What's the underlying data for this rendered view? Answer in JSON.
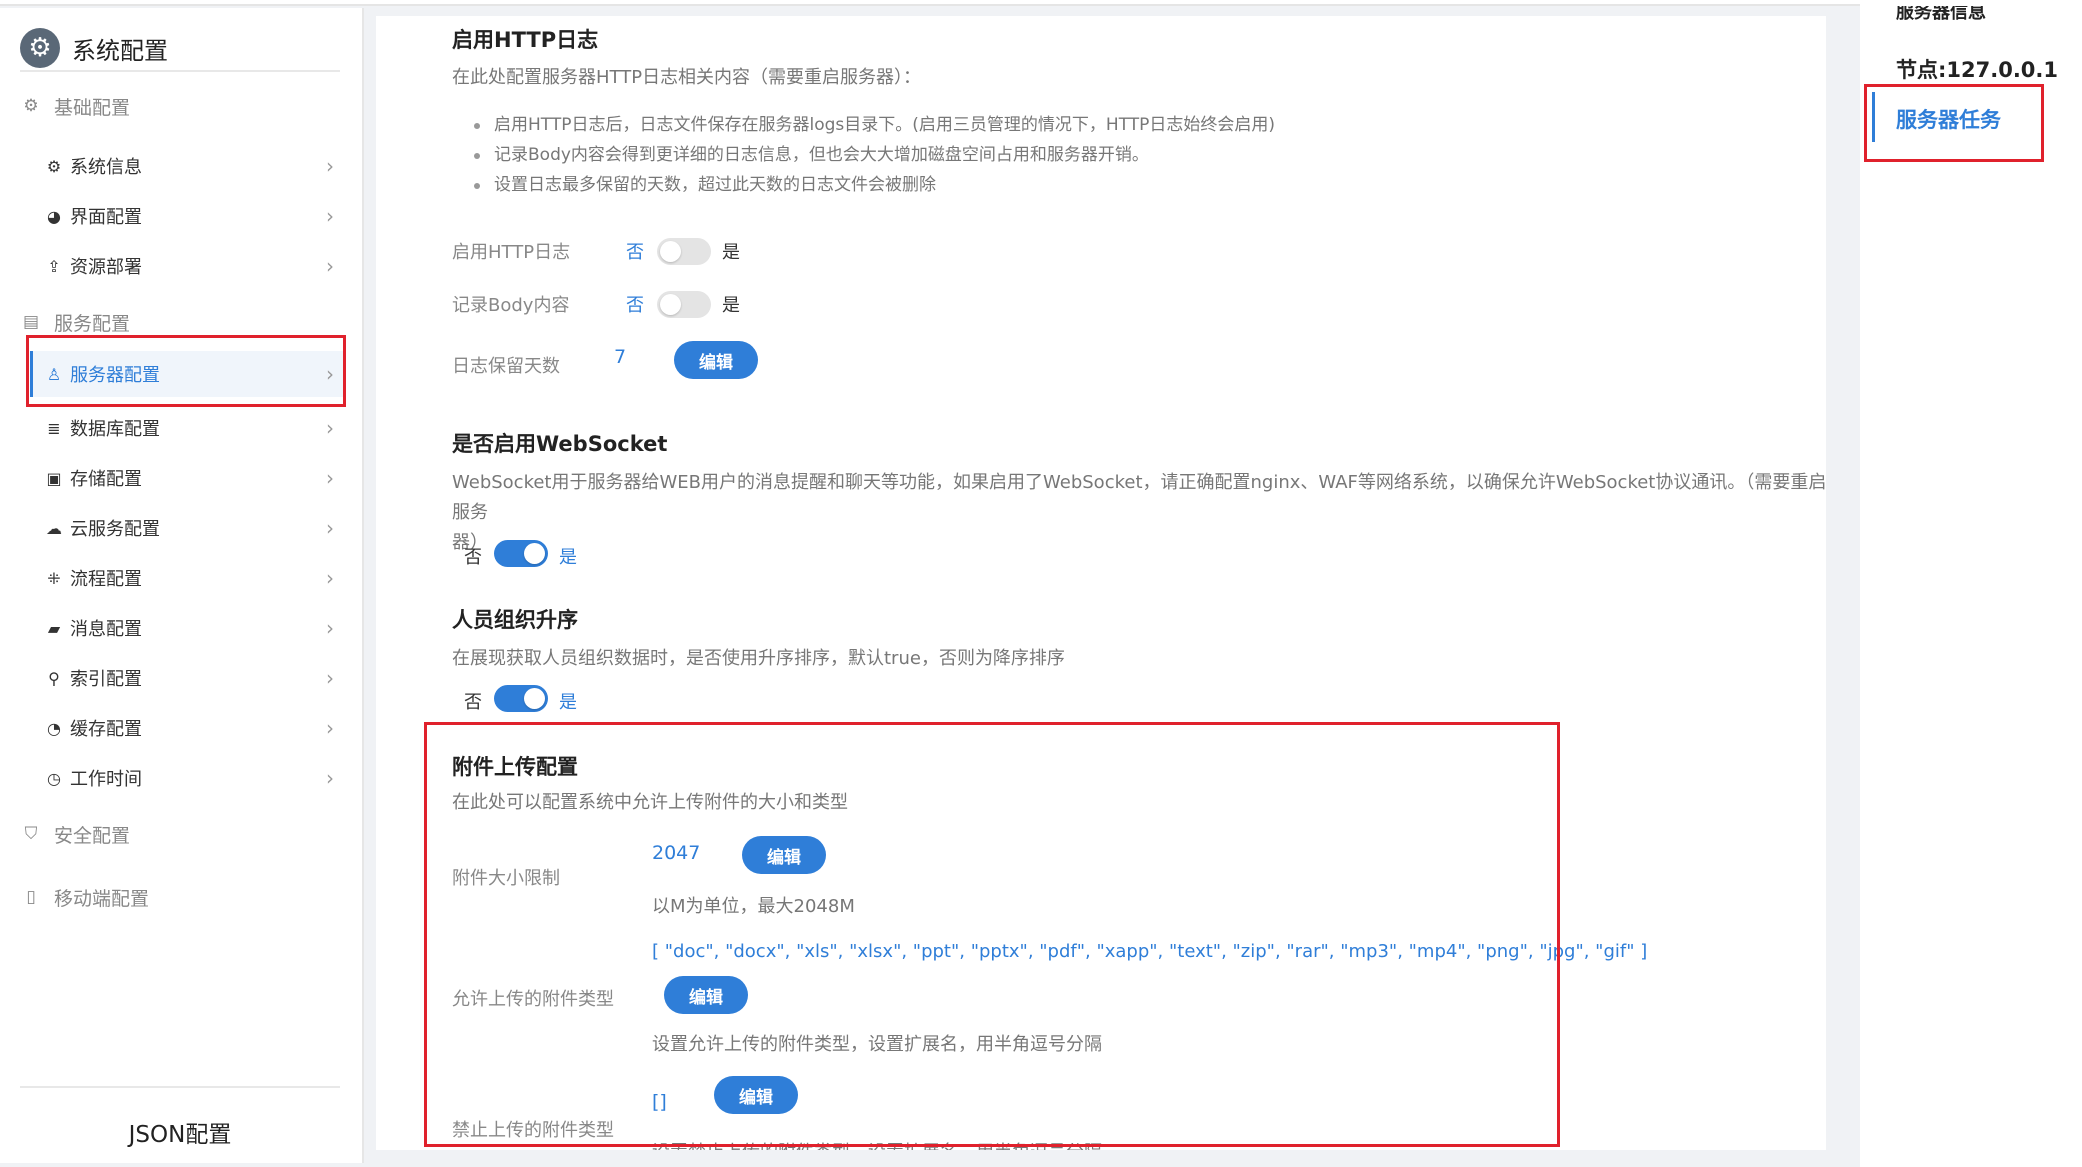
{
  "sidebar": {
    "title": "系统配置",
    "groups": [
      {
        "label": "基础配置",
        "icon": "gear-icon"
      },
      {
        "label": "服务配置",
        "icon": "server-group-icon"
      },
      {
        "label": "安全配置",
        "icon": "shield-icon"
      },
      {
        "label": "移动端配置",
        "icon": "mobile-icon"
      }
    ],
    "items": [
      {
        "label": "系统信息",
        "icon": "gear-icon"
      },
      {
        "label": "界面配置",
        "icon": "palette-icon"
      },
      {
        "label": "资源部署",
        "icon": "upload-icon"
      },
      {
        "label": "服务器配置",
        "icon": "server-user-icon",
        "active": true
      },
      {
        "label": "数据库配置",
        "icon": "database-icon"
      },
      {
        "label": "存储配置",
        "icon": "storage-icon"
      },
      {
        "label": "云服务配置",
        "icon": "cloud-icon"
      },
      {
        "label": "流程配置",
        "icon": "flow-icon"
      },
      {
        "label": "消息配置",
        "icon": "message-icon"
      },
      {
        "label": "索引配置",
        "icon": "search-icon"
      },
      {
        "label": "缓存配置",
        "icon": "cache-icon"
      },
      {
        "label": "工作时间",
        "icon": "clock-icon"
      }
    ],
    "json_button": "JSON配置"
  },
  "http_log": {
    "title": "启用HTTP日志",
    "desc": "在此处配置服务器HTTP日志相关内容（需要重启服务器）：",
    "bullets": [
      "启用HTTP日志后，日志文件保存在服务器logs目录下。(启用三员管理的情况下，HTTP日志始终会启用)",
      "记录Body内容会得到更详细的日志信息，但也会大大增加磁盘空间占用和服务器开销。",
      "设置日志最多保留的天数，超过此天数的日志文件会被删除"
    ],
    "enable_label": "启用HTTP日志",
    "body_label": "记录Body内容",
    "days_label": "日志保留天数",
    "days_value": "7",
    "no": "否",
    "yes": "是",
    "edit": "编辑",
    "enable_on": false,
    "body_on": false
  },
  "websocket": {
    "title": "是否启用WebSocket",
    "desc_line1": "WebSocket用于服务器给WEB用户的消息提醒和聊天等功能，如果启用了WebSocket，请正确配置nginx、WAF等网络系统，以确保允许WebSocket协议通讯。（需要重启服务",
    "desc_line2": "器）",
    "no": "否",
    "yes": "是",
    "on": true
  },
  "org_sort": {
    "title": "人员组织升序",
    "desc": "在展现获取人员组织数据时，是否使用升序排序，默认true，否则为降序排序",
    "no": "否",
    "yes": "是",
    "on": true
  },
  "attachment": {
    "title": "附件上传配置",
    "desc": "在此处可以配置系统中允许上传附件的大小和类型",
    "size_label": "附件大小限制",
    "size_value": "2047",
    "size_hint": "以M为单位，最大2048M",
    "allowed_label": "允许上传的附件类型",
    "allowed_value": "[ \"doc\", \"docx\", \"xls\", \"xlsx\", \"ppt\", \"pptx\", \"pdf\", \"xapp\", \"text\", \"zip\", \"rar\", \"mp3\", \"mp4\", \"png\", \"jpg\", \"gif\" ]",
    "allowed_hint": "设置允许上传的附件类型，设置扩展名，用半角逗号分隔",
    "forbidden_label": "禁止上传的附件类型",
    "forbidden_value": "[]",
    "forbidden_hint": "设置禁止上传的附件类型，设置扩展名，用半角逗号分隔",
    "edit": "编辑"
  },
  "right_nav": {
    "cut_label": "服务器信息",
    "node": "节点:127.0.0.1",
    "task": "服务器任务"
  },
  "colors": {
    "accent": "#2f7ed8",
    "highlight_box": "#e0212c"
  }
}
